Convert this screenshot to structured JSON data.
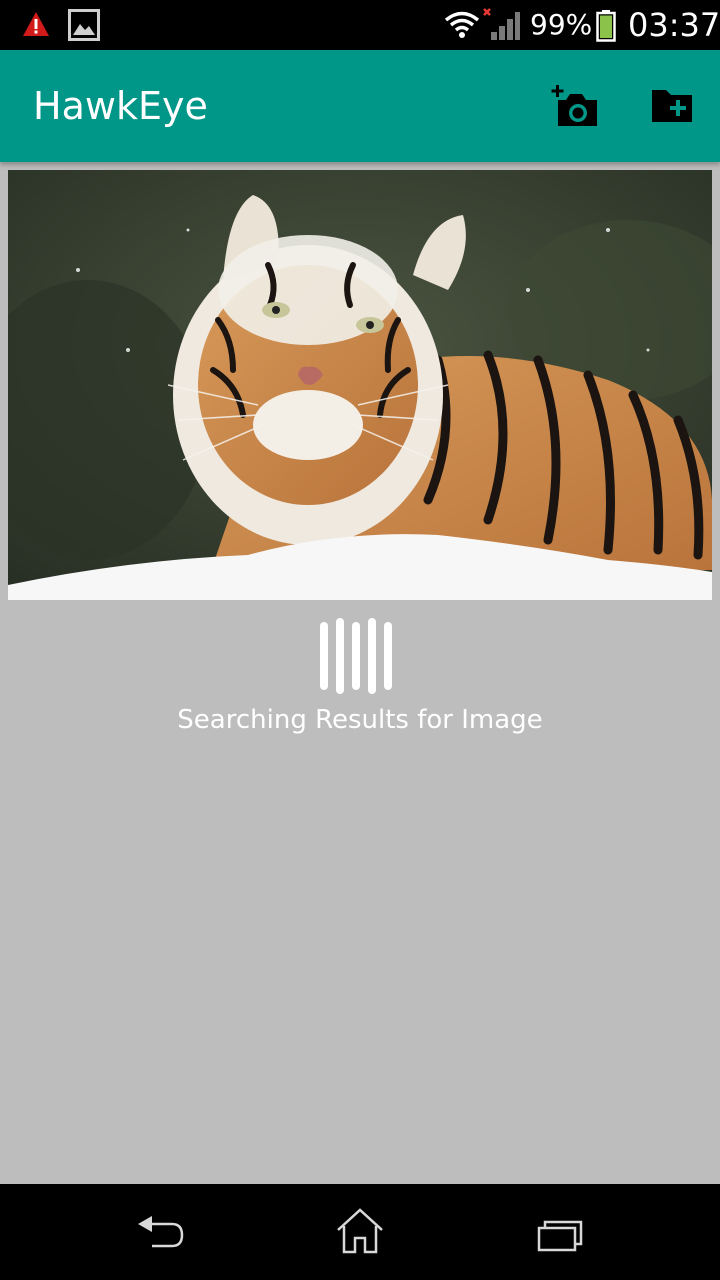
{
  "status_bar": {
    "battery_percent": "99%",
    "time": "03:37",
    "icons": [
      "warning-icon",
      "image-notification-icon",
      "wifi-icon",
      "signal-icon",
      "battery-icon"
    ]
  },
  "app_bar": {
    "title": "HawkEye",
    "color": "#009688",
    "actions": [
      "add-camera-icon",
      "add-folder-icon"
    ]
  },
  "content": {
    "image_icon": "tiger-photo",
    "loader_icon": "loading-bars-icon",
    "status_message": "Searching Results for Image"
  },
  "nav_bar": {
    "buttons": [
      "back-icon",
      "home-icon",
      "recent-apps-icon"
    ]
  }
}
